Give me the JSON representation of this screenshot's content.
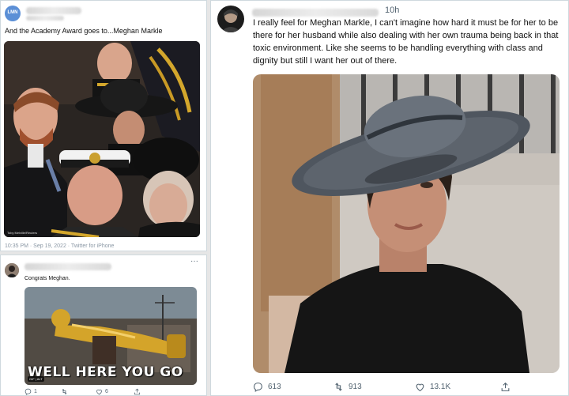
{
  "left_top": {
    "avatar_text": "LMN",
    "text": "And the Academy Award goes to...Meghan Markle",
    "photo_credit": "Toby Melville/Reuters",
    "timestamp": "10:35 PM · Sep 19, 2022 · Twitter for iPhone"
  },
  "left_bottom": {
    "text": "Congrats Meghan.",
    "gif_caption": "WELL HERE YOU GO",
    "gif_badge": "GIF | ALT",
    "replies": "1",
    "likes": "6"
  },
  "right": {
    "time": "10h",
    "text": "I really feel for Meghan Markle, I can't imagine how hard it must be for her to be there for her husband while also dealing with her own trauma being back in that toxic environment. Like she seems to be handling everything with class and dignity but still I want her out of there.",
    "replies": "613",
    "retweets": "913",
    "likes": "13.1K"
  },
  "icons": [
    "reply-icon",
    "retweet-icon",
    "like-icon",
    "share-icon",
    "more-icon"
  ]
}
